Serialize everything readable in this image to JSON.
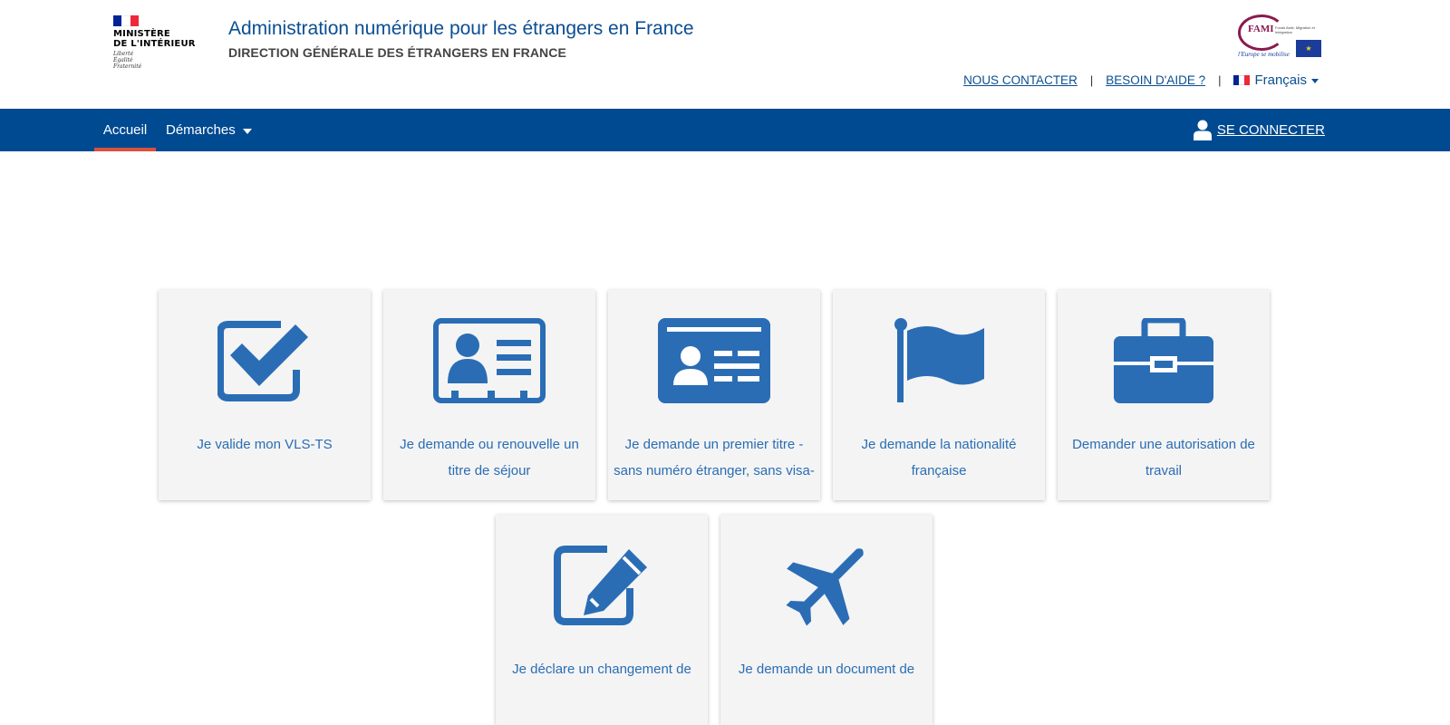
{
  "header": {
    "ministry_name_lines": [
      "MINISTÈRE",
      "DE L'INTÉRIEUR"
    ],
    "ministry_motto": [
      "Liberté",
      "Égalité",
      "Fraternité"
    ],
    "site_title": "Administration numérique pour les étrangers en France",
    "site_subtitle": "DIRECTION GÉNÉRALE DES ÉTRANGERS EN FRANCE",
    "partner_logo": {
      "word": "FAMI",
      "small_text": "Fonds Asile, Migration et Intégration",
      "slogan": "l'Europe se mobilise"
    },
    "links": {
      "contact": "NOUS CONTACTER",
      "help": "BESOIN D'AIDE ?",
      "separator": "|",
      "language": "Français"
    }
  },
  "nav": {
    "home": "Accueil",
    "procedures": "Démarches",
    "login": "SE CONNECTER"
  },
  "tiles": [
    {
      "label": "Je valide mon VLS-TS",
      "icon": "checkbox-checked-icon"
    },
    {
      "label": "Je demande ou renouvelle un titre de séjour",
      "icon": "id-badge-icon"
    },
    {
      "label": "Je demande un premier titre -sans numéro étranger, sans visa-",
      "icon": "id-card-icon"
    },
    {
      "label": "Je demande la nationalité française",
      "icon": "flag-icon"
    },
    {
      "label": "Demander une autorisation de travail",
      "icon": "briefcase-icon"
    },
    {
      "label": "Je déclare un changement de",
      "icon": "edit-icon"
    },
    {
      "label": "Je demande un document de",
      "icon": "airplane-icon"
    }
  ],
  "colors": {
    "primary_blue": "#004a92",
    "icon_blue": "#2a6db5",
    "nav_active_underline": "#d9513c",
    "tile_bg": "#f4f4f4"
  }
}
